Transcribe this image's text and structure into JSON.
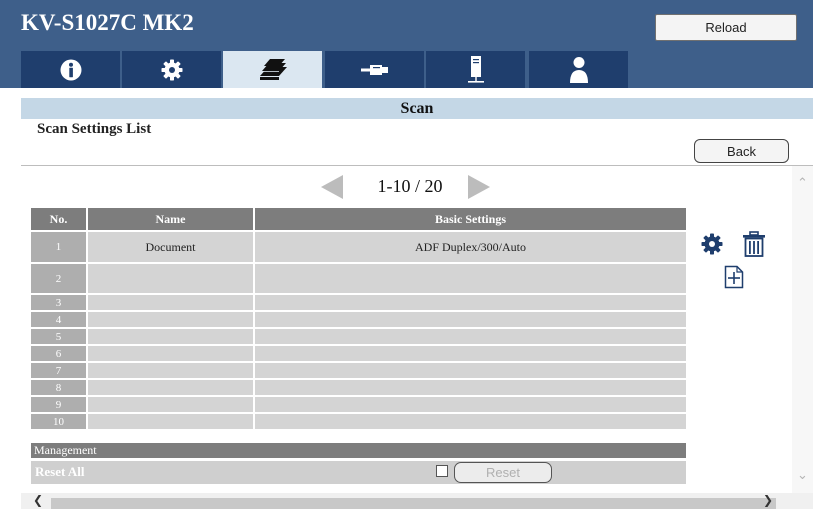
{
  "header": {
    "device_title": "KV-S1027C MK2",
    "reload_label": "Reload",
    "tabs": [
      {
        "icon": "info-icon",
        "active": false
      },
      {
        "icon": "gear-icon",
        "active": false
      },
      {
        "icon": "document-stack-icon",
        "active": true
      },
      {
        "icon": "network-cable-icon",
        "active": false
      },
      {
        "icon": "server-icon",
        "active": false
      },
      {
        "icon": "user-icon",
        "active": false
      }
    ]
  },
  "page": {
    "section_title": "Scan",
    "subtitle": "Scan Settings List",
    "back_label": "Back"
  },
  "pager": {
    "text": "1-10 / 20"
  },
  "table": {
    "columns": [
      "No.",
      "Name",
      "Basic Settings"
    ],
    "rows": [
      {
        "no": "1",
        "name": "Document",
        "basic": "ADF Duplex/300/Auto"
      },
      {
        "no": "2",
        "name": "",
        "basic": ""
      },
      {
        "no": "3",
        "name": "",
        "basic": ""
      },
      {
        "no": "4",
        "name": "",
        "basic": ""
      },
      {
        "no": "5",
        "name": "",
        "basic": ""
      },
      {
        "no": "6",
        "name": "",
        "basic": ""
      },
      {
        "no": "7",
        "name": "",
        "basic": ""
      },
      {
        "no": "8",
        "name": "",
        "basic": ""
      },
      {
        "no": "9",
        "name": "",
        "basic": ""
      },
      {
        "no": "10",
        "name": "",
        "basic": ""
      }
    ]
  },
  "actions": {
    "settings_icon": "gear-icon",
    "delete_icon": "trash-icon",
    "add_icon": "add-document-icon"
  },
  "management": {
    "title": "Management",
    "reset_all_label": "Reset All",
    "reset_label": "Reset",
    "reset_checked": false
  },
  "colors": {
    "header_bg": "#3e5f8a",
    "tab_bg": "#1f3e6d",
    "tab_active_bg": "#dbe7f1",
    "section_bar": "#c4d7e6",
    "action_icon": "#1f3e6d"
  }
}
